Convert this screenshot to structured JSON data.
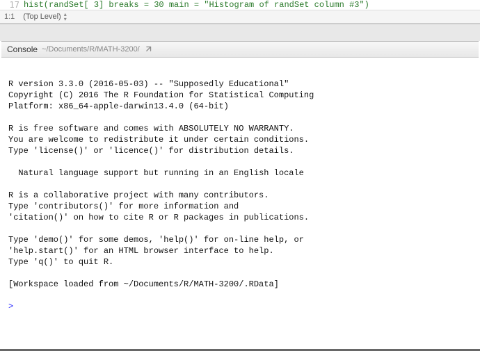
{
  "source": {
    "line_number": "17",
    "code_fragment": "hist(randSet[ 3]  breaks = 30  main = \"Histogram of randSet column #3\")",
    "cursor_pos": "1:1",
    "scope_label": "(Top Level)"
  },
  "console": {
    "title": "Console",
    "path": "~/Documents/R/MATH-3200/",
    "lines": [
      "",
      "R version 3.3.0 (2016-05-03) -- \"Supposedly Educational\"",
      "Copyright (C) 2016 The R Foundation for Statistical Computing",
      "Platform: x86_64-apple-darwin13.4.0 (64-bit)",
      "",
      "R is free software and comes with ABSOLUTELY NO WARRANTY.",
      "You are welcome to redistribute it under certain conditions.",
      "Type 'license()' or 'licence()' for distribution details.",
      "",
      "  Natural language support but running in an English locale",
      "",
      "R is a collaborative project with many contributors.",
      "Type 'contributors()' for more information and",
      "'citation()' on how to cite R or R packages in publications.",
      "",
      "Type 'demo()' for some demos, 'help()' for on-line help, or",
      "'help.start()' for an HTML browser interface to help.",
      "Type 'q()' to quit R.",
      "",
      "[Workspace loaded from ~/Documents/R/MATH-3200/.RData]",
      ""
    ],
    "prompt": ">"
  }
}
